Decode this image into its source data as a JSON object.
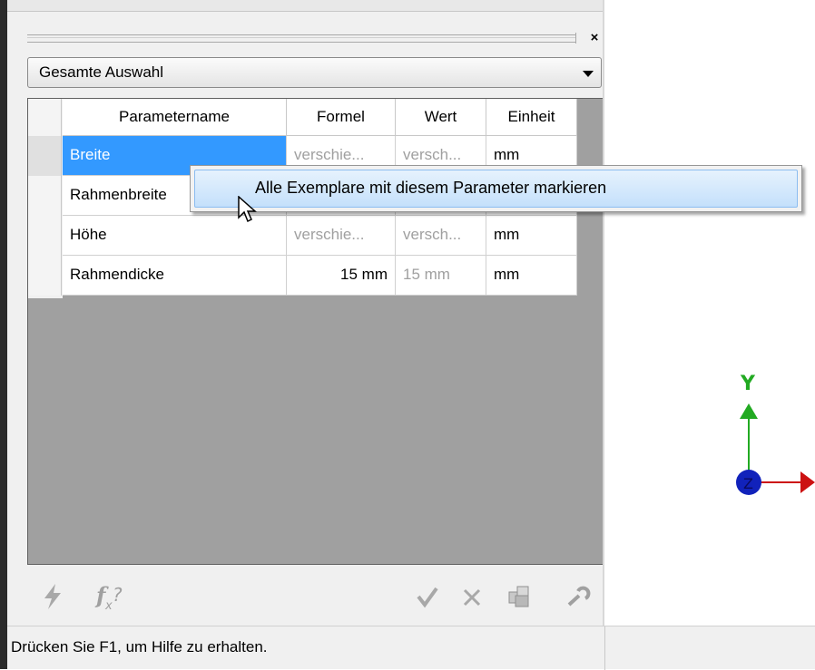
{
  "panel": {
    "close_glyph": "×",
    "dropdown": {
      "selected": "Gesamte Auswahl"
    }
  },
  "table": {
    "columns": [
      "Parametername",
      "Formel",
      "Wert",
      "Einheit"
    ],
    "rows": [
      {
        "name": "Breite",
        "formula": "verschie...",
        "value": "versch...",
        "unit": "mm",
        "selected": true
      },
      {
        "name": "Rahmenbreite",
        "formula": "",
        "value": "",
        "unit": "",
        "selected": false
      },
      {
        "name": "Höhe",
        "formula": "verschie...",
        "value": "versch...",
        "unit": "mm",
        "selected": false
      },
      {
        "name": "Rahmendicke",
        "formula": "15 mm",
        "value": "15 mm",
        "unit": "mm",
        "selected": false
      }
    ]
  },
  "context_menu": {
    "items": [
      "Alle Exemplare mit diesem Parameter markieren"
    ]
  },
  "toolbar": {
    "icons": [
      "lightning-icon",
      "function-help-icon",
      "checkmark-icon",
      "cancel-icon",
      "copy-icon",
      "wrench-icon"
    ]
  },
  "viewport": {
    "axis_y_label": "Y",
    "axis_z_label": "Z",
    "colors": {
      "y_axis": "#22aa22",
      "x_axis": "#cc1111",
      "z_axis": "#1122bb"
    }
  },
  "statusbar": {
    "text": "Drücken Sie F1, um Hilfe zu erhalten."
  },
  "colors": {
    "selection": "#3399ff",
    "grid_background": "#a0a0a0",
    "menu_highlight": "#c4e0fb"
  }
}
